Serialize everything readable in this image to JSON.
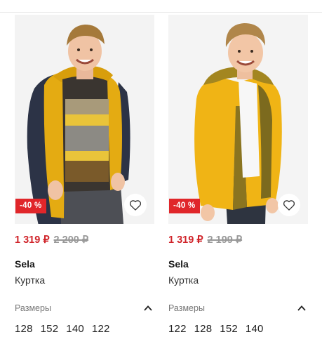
{
  "products": [
    {
      "discount": "-40 %",
      "price_now": "1 319 ₽",
      "price_old": "2 200 ₽",
      "brand": "Sela",
      "type": "Куртка",
      "sizes_label": "Размеры",
      "sizes": [
        "128",
        "152",
        "140",
        "122"
      ],
      "jacket_color": "#e4ab12",
      "photo_bg": "#f3f3f3"
    },
    {
      "discount": "-40 %",
      "price_now": "1 319 ₽",
      "price_old": "2 199 ₽",
      "brand": "Sela",
      "type": "Куртка",
      "sizes_label": "Размеры",
      "sizes": [
        "122",
        "128",
        "152",
        "140"
      ],
      "jacket_color": "#f0b415",
      "photo_bg": "#f4f4f4"
    }
  ],
  "icons": {
    "favorite": "heart-outline",
    "sizes_toggle": "chevron-up"
  },
  "colors": {
    "sale_price": "#d0242a",
    "badge": "#e0262a"
  }
}
